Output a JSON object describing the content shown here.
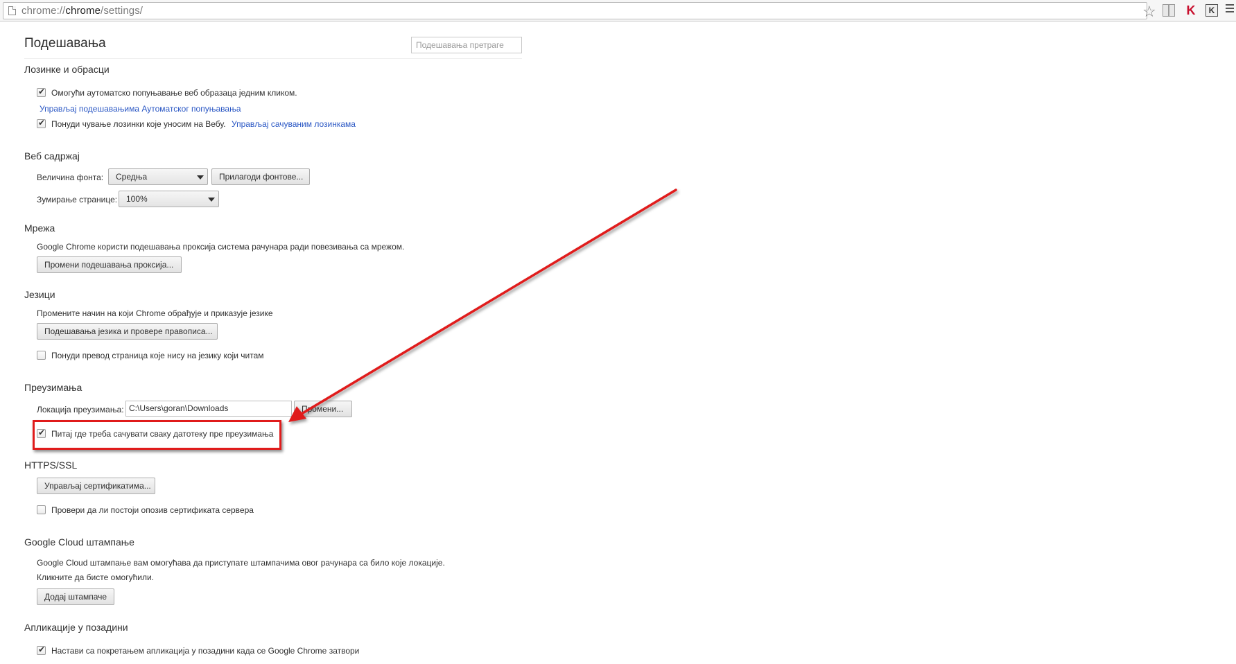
{
  "browser": {
    "url_scheme": "chrome://",
    "url_host": "chrome",
    "url_path": "/settings/",
    "icons": [
      "page-icon",
      "star-icon",
      "reader-icon",
      "kaspersky-icon",
      "k-extension-icon",
      "menu-icon"
    ]
  },
  "page": {
    "title": "Подешавања",
    "search_placeholder": "Подешавања претраге"
  },
  "passwords": {
    "title": "Лозинке и обрасци",
    "autofill_label": "Омогући аутоматско попуњавање веб образаца једним кликом.",
    "autofill_checked": true,
    "autofill_link": "Управљај подешавањима Аутоматског попуњавања",
    "save_passwords_label": "Понуди чување лозинки које уносим на Вебу.",
    "save_passwords_checked": true,
    "save_passwords_link": "Управљај сачуваним лозинкама"
  },
  "web_content": {
    "title": "Веб садржај",
    "font_size_label": "Величина фонта:",
    "font_size_value": "Средња",
    "customize_fonts_button": "Прилагоди фонтове...",
    "zoom_label": "Зумирање странице:",
    "zoom_value": "100%"
  },
  "network": {
    "title": "Мрежа",
    "description": "Google Chrome користи подешавања проксија система рачунара ради повезивања са мрежом.",
    "proxy_button": "Промени подешавања проксија..."
  },
  "languages": {
    "title": "Језици",
    "description": "Промените начин на који Chrome обрађује и приказује језике",
    "settings_button": "Подешавања језика и провере правописа...",
    "translate_label": "Понуди превод страница које нису на језику који читам",
    "translate_checked": false
  },
  "downloads": {
    "title": "Преузимања",
    "location_label": "Локација преузимања:",
    "location_value": "C:\\Users\\goran\\Downloads",
    "change_button": "Промени...",
    "ask_label": "Питај где треба сачувати сваку датотеку пре преузимања",
    "ask_checked": true
  },
  "https": {
    "title": "HTTPS/SSL",
    "certificates_button": "Управљај сертификатима...",
    "revocation_label": "Провери да ли постоји опозив сертификата сервера",
    "revocation_checked": false
  },
  "cloud_print": {
    "title": "Google Cloud штампање",
    "description": "Google Cloud штампање вам омогућава да приступате штампачима овог рачунара са било које локације.",
    "hint": "Кликните да бисте омогућили.",
    "add_button": "Додај штампаче"
  },
  "background_apps": {
    "title": "Апликације у позадини",
    "continue_label": "Настави са покретањем апликација у позадини када се Google Chrome затвори",
    "continue_checked": true
  },
  "annotation": {
    "color": "#e01b1b"
  }
}
